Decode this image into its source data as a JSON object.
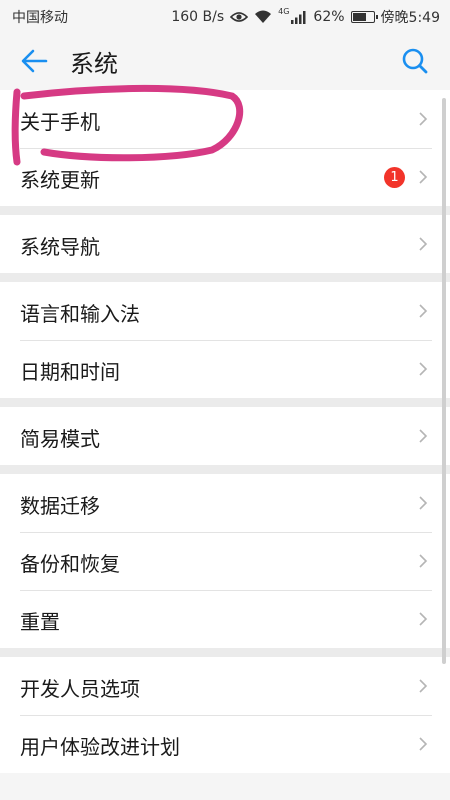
{
  "status_bar": {
    "carrier": "中国移动",
    "speed": "160 B/s",
    "network_tag": "4G",
    "battery": "62%",
    "battery_level": 0.62,
    "time": "傍晚5:49"
  },
  "header": {
    "title": "系统",
    "back_icon": "back-arrow-icon",
    "search_icon": "search-icon"
  },
  "groups": [
    {
      "items": [
        {
          "label": "关于手机"
        },
        {
          "label": "系统更新",
          "badge": "1"
        }
      ]
    },
    {
      "items": [
        {
          "label": "系统导航"
        }
      ]
    },
    {
      "items": [
        {
          "label": "语言和输入法"
        },
        {
          "label": "日期和时间"
        }
      ]
    },
    {
      "items": [
        {
          "label": "简易模式"
        }
      ]
    },
    {
      "items": [
        {
          "label": "数据迁移"
        },
        {
          "label": "备份和恢复"
        },
        {
          "label": "重置"
        }
      ]
    },
    {
      "items": [
        {
          "label": "开发人员选项"
        },
        {
          "label": "用户体验改进计划"
        }
      ]
    }
  ],
  "colors": {
    "accent": "#1a8ff0",
    "badge": "#f2342a",
    "annotation": "#d63a84"
  }
}
